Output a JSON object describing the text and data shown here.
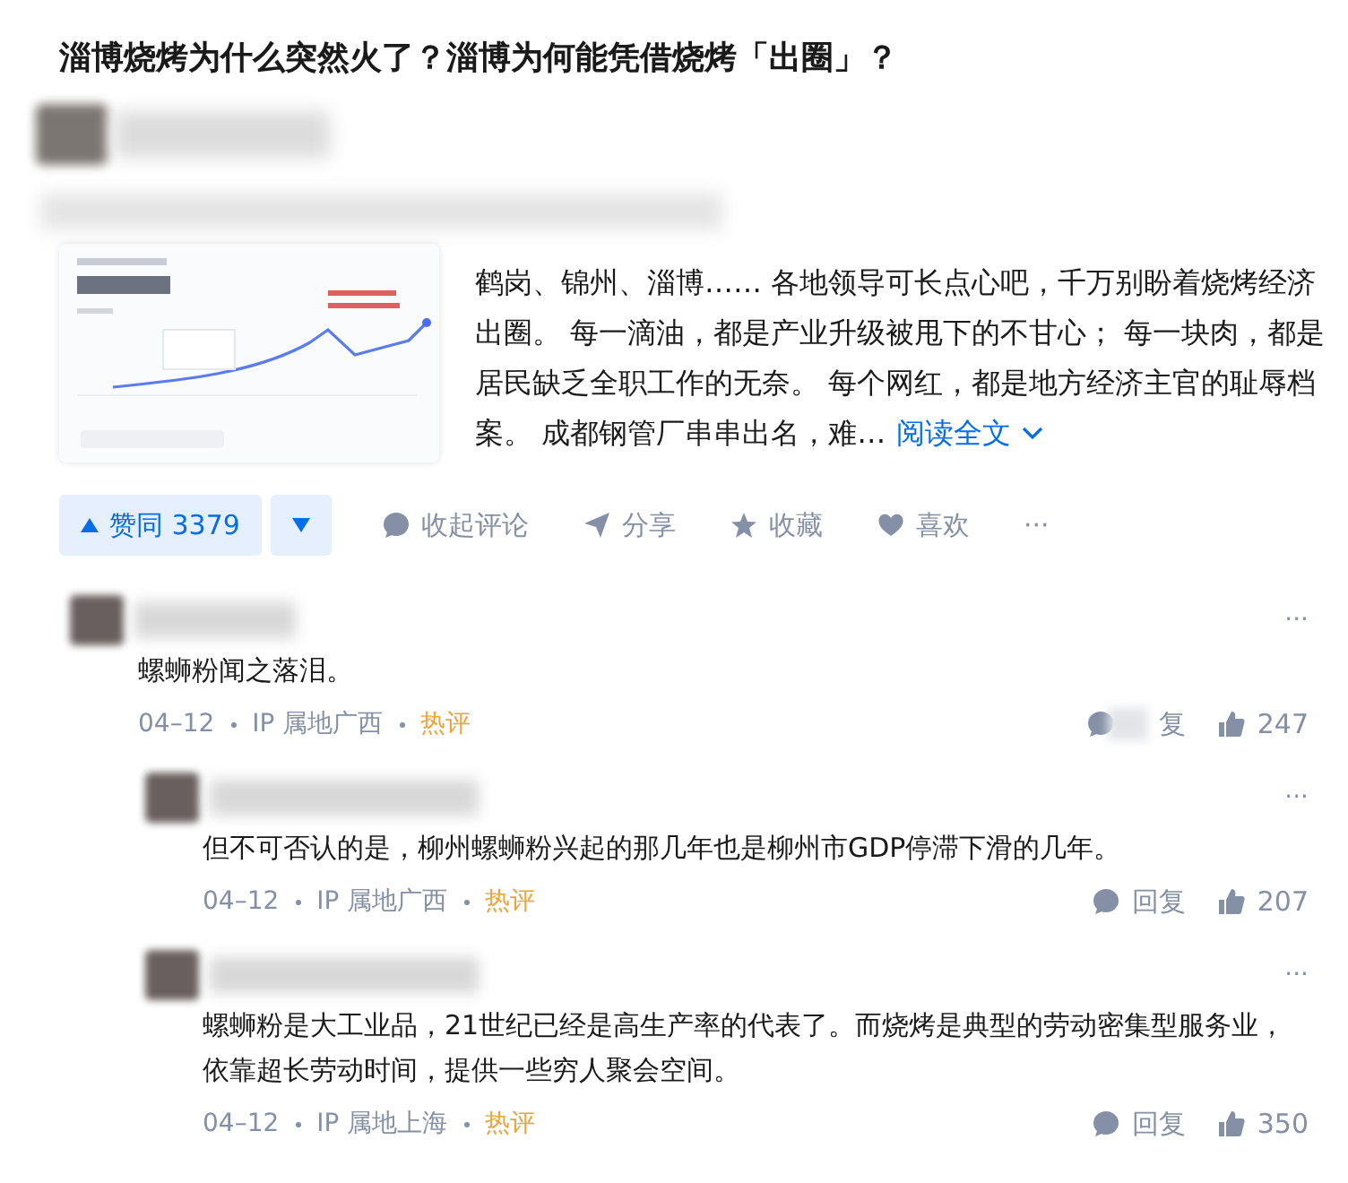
{
  "question": {
    "title": "淄博烧烤为什么突然火了？淄博为何能凭借烧烤「出圈」？"
  },
  "answer": {
    "thumbnail": {
      "kind": "picture"
    },
    "excerpt_lines": [
      "鹤岗、锦州、淄博…… 各地领导可长点心吧，千万别盼着烧烤经济",
      "出圈。 每一滴油，都是产业升级被甩下的不甘心； 每一块肉，都是",
      "居民缺乏全职工作的无奈。 每个网红，都是地方经济主官的耻辱档",
      "案。 成都钢管厂串串出名，难…"
    ],
    "read_more": "阅读全文"
  },
  "actions": {
    "upvote": {
      "label": "赞同 3379",
      "selected": false
    },
    "items": [
      {
        "kind": "comment",
        "label": "收起评论"
      },
      {
        "kind": "share",
        "label": "分享"
      },
      {
        "kind": "star",
        "label": "收藏"
      },
      {
        "kind": "heart",
        "label": "喜欢"
      },
      {
        "kind": "more",
        "label": "···"
      }
    ]
  },
  "comments": [
    {
      "text": "螺蛳粉闻之落泪。",
      "date": "04–12",
      "ip": "IP 属地广西",
      "tag": "热评",
      "reply_label": "复",
      "reply_blurred": true,
      "likes": "247",
      "more": "···",
      "children": [
        {
          "text": "但不可否认的是，柳州螺蛳粉兴起的那几年也是柳州市GDP停滞下滑的几年。",
          "date": "04–12",
          "ip": "IP 属地广西",
          "tag": "热评",
          "reply_label": "回复",
          "reply_blurred": false,
          "likes": "207",
          "more": "···"
        },
        {
          "text": "螺蛳粉是大工业品，21世纪已经是高生产率的代表了。而烧烤是典型的劳动密集型服务业，依靠超长劳动时间，提供一些穷人聚会空间。",
          "date": "04–12",
          "ip": "IP 属地上海",
          "tag": "热评",
          "reply_label": "回复",
          "reply_blurred": false,
          "likes": "350",
          "more": "···"
        }
      ]
    }
  ]
}
